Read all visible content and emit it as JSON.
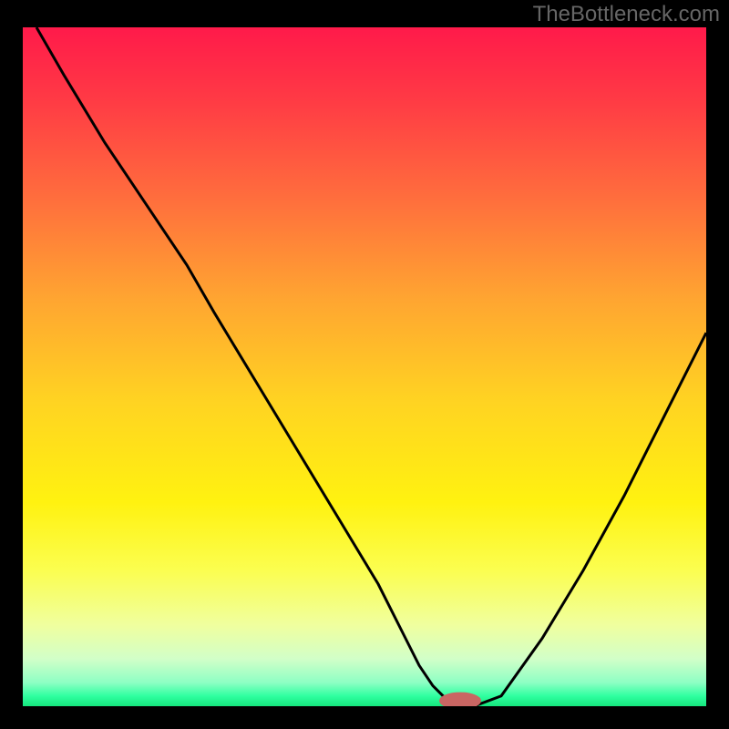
{
  "watermark": "TheBottleneck.com",
  "colors": {
    "black": "#000000",
    "curve": "#000000",
    "marker_fill": "#c96663",
    "marker_stroke": "#c96663"
  },
  "chart_data": {
    "type": "line",
    "title": "",
    "xlabel": "",
    "ylabel": "",
    "xlim": [
      0,
      100
    ],
    "ylim": [
      0,
      100
    ],
    "gradient_stops": [
      {
        "offset": 0.0,
        "color": "#ff1a4a"
      },
      {
        "offset": 0.1,
        "color": "#ff3845"
      },
      {
        "offset": 0.25,
        "color": "#ff6d3d"
      },
      {
        "offset": 0.4,
        "color": "#ffa531"
      },
      {
        "offset": 0.55,
        "color": "#ffd322"
      },
      {
        "offset": 0.7,
        "color": "#fff210"
      },
      {
        "offset": 0.8,
        "color": "#fbfe50"
      },
      {
        "offset": 0.88,
        "color": "#f0ff9e"
      },
      {
        "offset": 0.93,
        "color": "#d2ffc8"
      },
      {
        "offset": 0.965,
        "color": "#8effc4"
      },
      {
        "offset": 0.985,
        "color": "#2fffa0"
      },
      {
        "offset": 1.0,
        "color": "#15e67d"
      }
    ],
    "series": [
      {
        "name": "bottleneck-curve",
        "x": [
          2,
          6,
          12,
          18,
          24,
          28,
          34,
          40,
          46,
          52,
          56,
          58,
          60,
          62,
          64,
          66,
          70,
          76,
          82,
          88,
          94,
          100
        ],
        "values": [
          100,
          93,
          83,
          74,
          65,
          58,
          48,
          38,
          28,
          18,
          10,
          6,
          3,
          1,
          0,
          0,
          1.5,
          10,
          20,
          31,
          43,
          55
        ]
      }
    ],
    "marker": {
      "x": 64,
      "y": 0,
      "rx": 3,
      "ry": 1.2
    }
  }
}
